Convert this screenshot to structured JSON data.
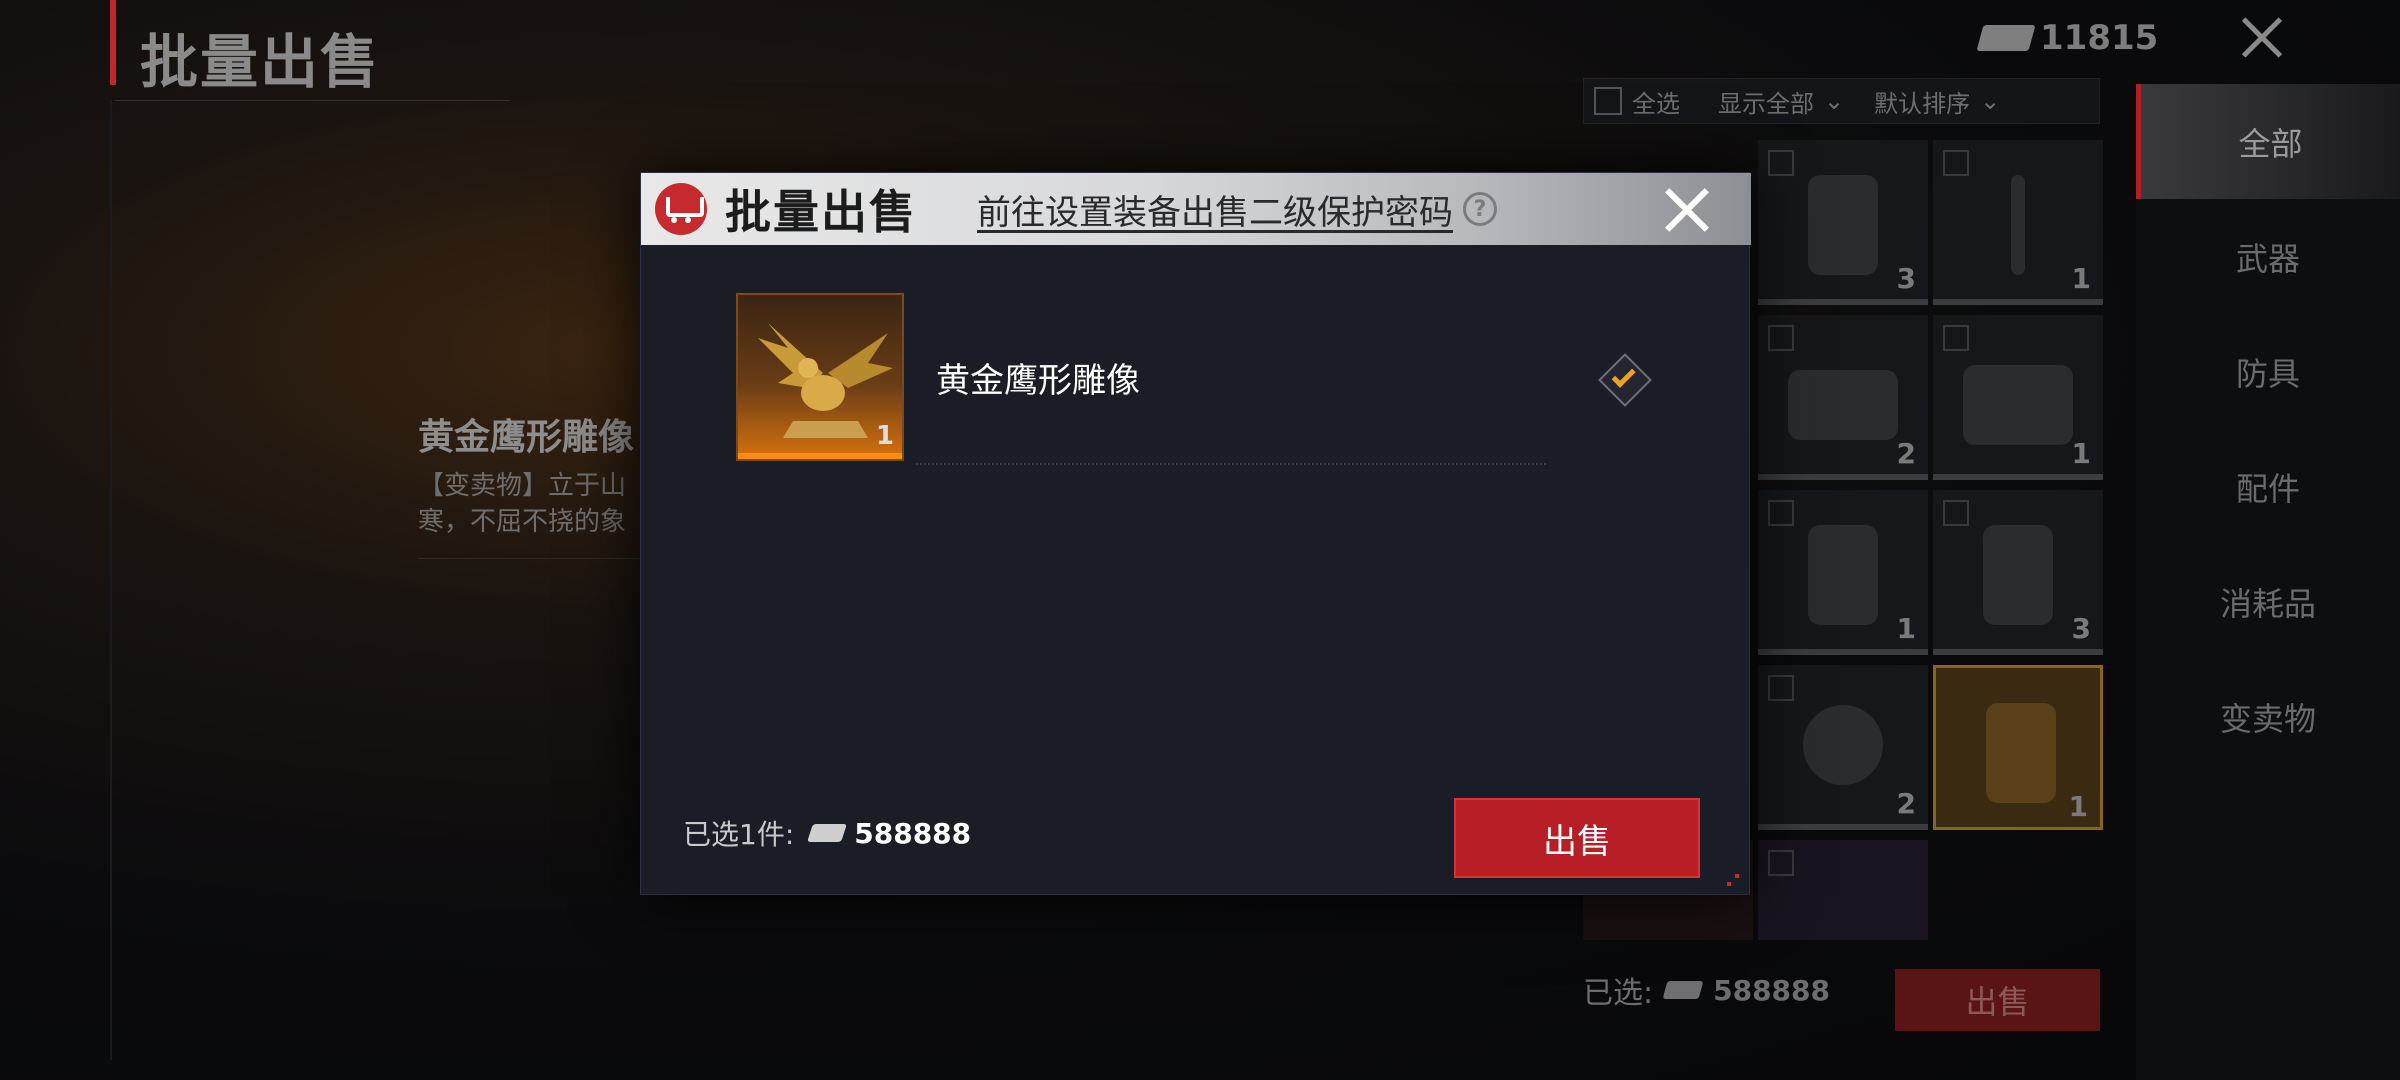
{
  "background": {
    "title": "批量出售",
    "currency_amount": "11815",
    "filters": {
      "select_all": "全选",
      "display": "显示全部",
      "sort": "默认排序"
    },
    "item_name": "黄金鹰形雕像",
    "item_desc": "【变卖物】立于山\n寒，不屈不挠的象",
    "grid_counts": [
      "3",
      "1",
      "2",
      "1",
      "1",
      "3",
      "2",
      "1"
    ],
    "sidebar": [
      "全部",
      "武器",
      "防具",
      "配件",
      "消耗品",
      "变卖物"
    ],
    "bottom": {
      "label": "已选:",
      "amount": "588888",
      "sell": "出售"
    }
  },
  "modal": {
    "title": "批量出售",
    "link": "前往设置装备出售二级保护密码",
    "help_symbol": "?",
    "item": {
      "name": "黄金鹰形雕像",
      "qty": "1",
      "checked": true
    },
    "footer": {
      "selected_label": "已选1件:",
      "amount": "588888"
    },
    "sell_button": "出售"
  },
  "colors": {
    "accent_red": "#b81e25",
    "check_orange": "#f0a21c",
    "rarity_orange": "#d7720f"
  }
}
